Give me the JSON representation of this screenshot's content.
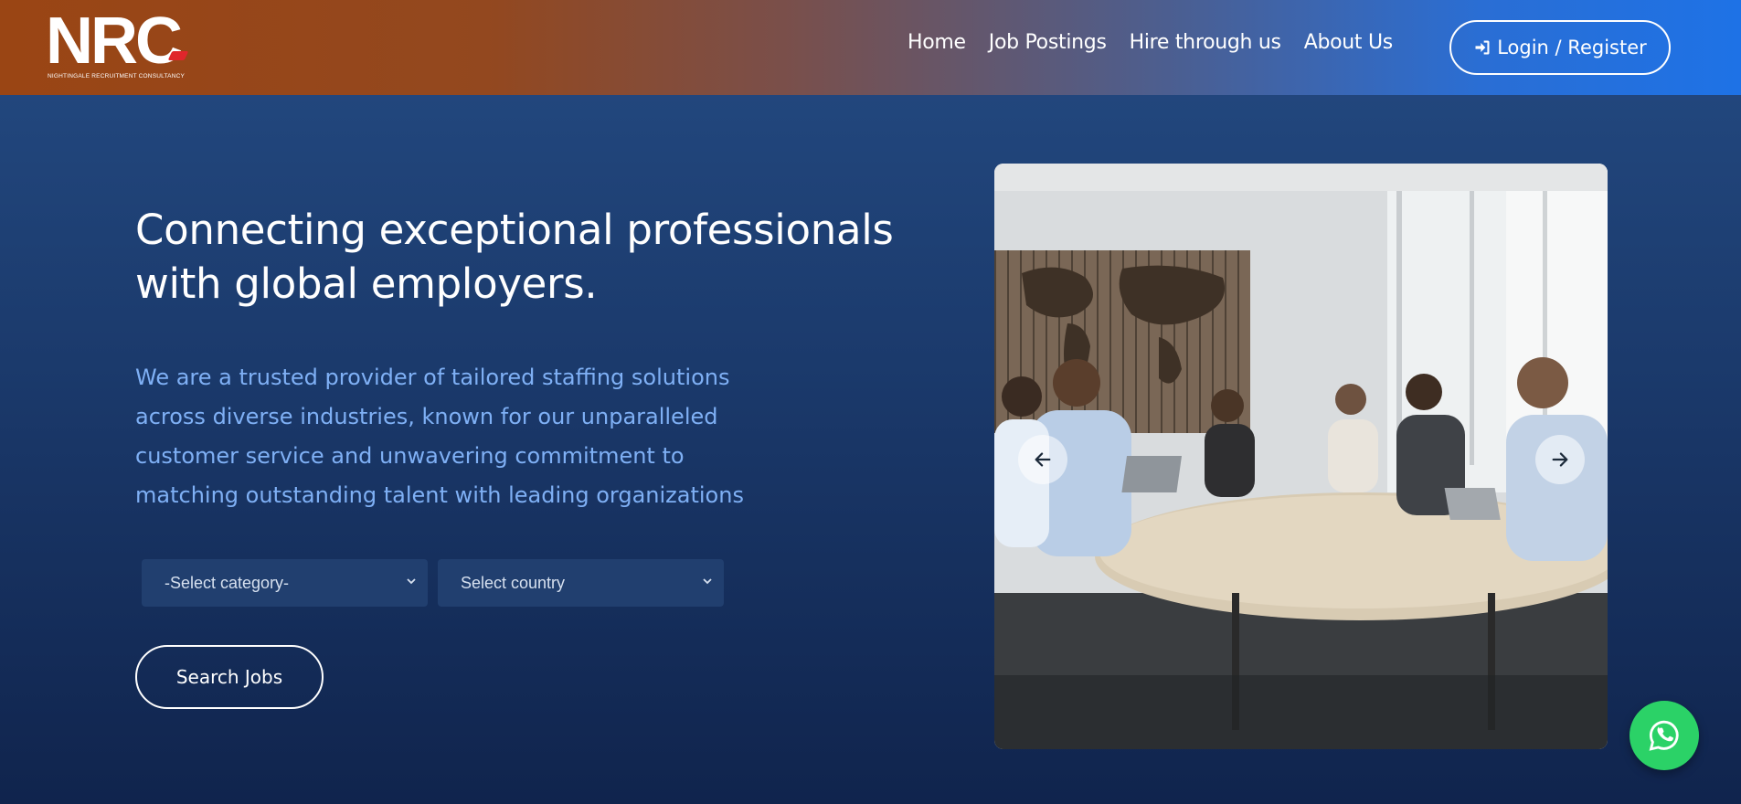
{
  "header": {
    "logo": {
      "mark": "NRC",
      "subtitle": "NIGHTINGALE RECRUITMENT CONSULTANCY"
    },
    "nav": [
      {
        "label": "Home"
      },
      {
        "label": "Job Postings"
      },
      {
        "label": "Hire through us"
      },
      {
        "label": "About Us"
      }
    ],
    "login_label": "Login / Register"
  },
  "hero": {
    "title_line1": "Connecting exceptional professionals",
    "title_line2": "with global employers.",
    "description": "We are a trusted provider of tailored staffing solutions across diverse industries, known for our unparalleled customer service and unwavering commitment to matching outstanding talent with leading organizations",
    "category_select": "-Select category-",
    "country_select": "Select country",
    "search_label": "Search Jobs"
  },
  "carousel": {
    "prev_icon": "arrow-left-icon",
    "next_icon": "arrow-right-icon"
  },
  "colors": {
    "header_start": "#9a4514",
    "header_end": "#1e72e6",
    "background": "#1b3a6c",
    "description_text": "#7fb0f5",
    "whatsapp": "#2bd267",
    "logo_accent": "#e0262b"
  },
  "icons": {
    "login": "sign-in-icon",
    "chat": "whatsapp-icon"
  }
}
